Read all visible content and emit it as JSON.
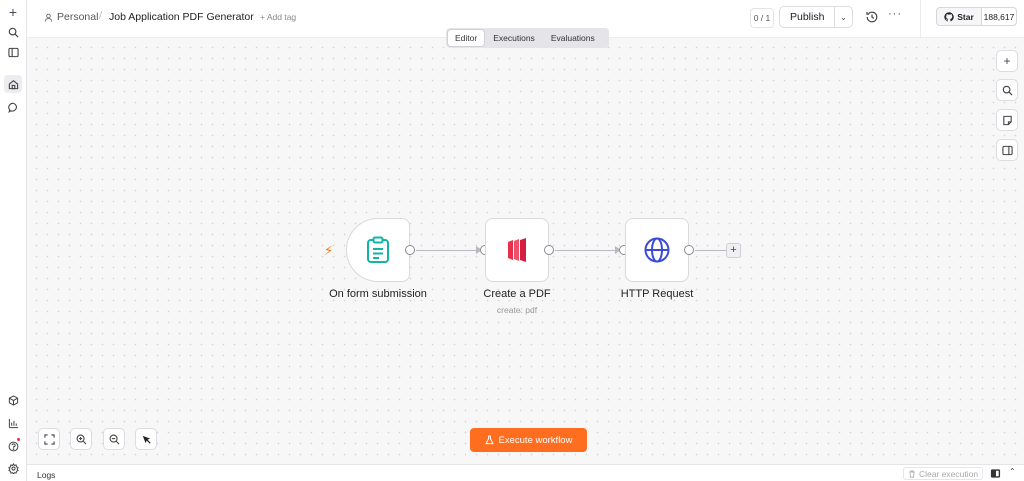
{
  "breadcrumb": {
    "owner": "Personal",
    "separator": "/",
    "workflow_name": "Job Application PDF Generator",
    "add_tag": "+ Add tag"
  },
  "header": {
    "version_counter": "0 / 1",
    "publish_label": "Publish",
    "github_star_label": "Star",
    "github_star_count": "188,617"
  },
  "tabs": [
    {
      "label": "Editor",
      "active": true
    },
    {
      "label": "Executions",
      "active": false
    },
    {
      "label": "Evaluations",
      "active": false
    }
  ],
  "left_sidebar": {
    "top_icons": [
      "plus-icon",
      "search-icon",
      "panel-icon",
      "home-icon",
      "chat-icon"
    ],
    "bottom_icons": [
      "templates-icon",
      "insights-icon",
      "help-icon",
      "settings-icon"
    ]
  },
  "right_toolbar": [
    "plus-icon",
    "search-icon",
    "sticky-note-icon",
    "panel-icon"
  ],
  "nodes": [
    {
      "label": "On form submission",
      "subtitle": "",
      "icon": "clipboard-icon",
      "trigger": true
    },
    {
      "label": "Create a PDF",
      "subtitle": "create: pdf",
      "icon": "pdf-logo-icon",
      "trigger": false
    },
    {
      "label": "HTTP Request",
      "subtitle": "",
      "icon": "globe-icon",
      "trigger": false
    }
  ],
  "bottom_toolbar": [
    "fit-view-icon",
    "zoom-in-icon",
    "zoom-out-icon",
    "select-mode-icon"
  ],
  "execute_button": {
    "label": "Execute workflow",
    "color": "#ff6d1f"
  },
  "logs": {
    "title": "Logs",
    "clear_label": "Clear execution"
  },
  "colors": {
    "accent": "#ff6d1f",
    "trigger_icon": "#12b3a8",
    "pdf_brand": "#e8304a",
    "http_icon": "#3b4bd8",
    "bolt": "#f07a25"
  }
}
